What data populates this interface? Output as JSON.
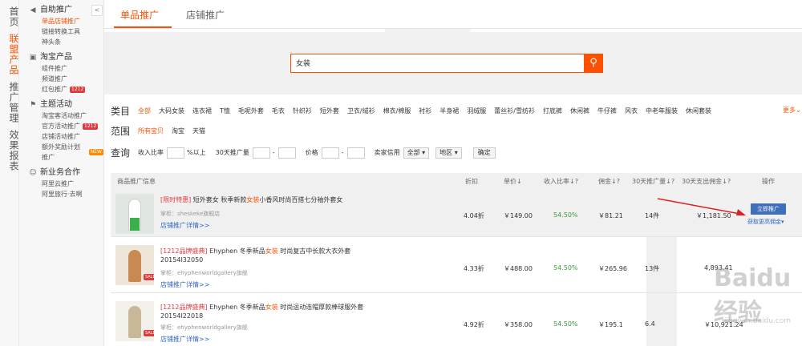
{
  "vnav": [
    "首页",
    "联盟产品",
    "推广管理",
    "效果报表"
  ],
  "sidebar": {
    "groups": [
      {
        "title": "自助推广",
        "items": [
          "单品店铺推广",
          "链接转换工具",
          "神头条"
        ]
      },
      {
        "title": "淘宝产品",
        "items": [
          "组件推广",
          "频道推广",
          "红包推广"
        ]
      },
      {
        "title": "主题活动",
        "items": [
          "淘宝客活动推广",
          "官方活动推广",
          "店铺活动推广",
          "额外奖励计划推广"
        ]
      },
      {
        "title": "新业务合作",
        "items": [
          "阿里云推广",
          "阿里旅行·去啊"
        ]
      }
    ],
    "collapse": "<"
  },
  "tabs": [
    "单品推广",
    "店铺推广"
  ],
  "search": {
    "value": "女装",
    "button": "搜索"
  },
  "filters": {
    "category_label": "类目",
    "categories": [
      "全部",
      "大码女装",
      "连衣裙",
      "T恤",
      "毛呢外套",
      "毛衣",
      "针织衫",
      "短外套",
      "卫衣/绒衫",
      "棉衣/棉服",
      "衬衫",
      "半身裙",
      "羽绒服",
      "蕾丝衫/雪纺衫",
      "打底裤",
      "休闲裤",
      "牛仔裤",
      "风衣",
      "中老年服装",
      "休闲套装"
    ],
    "more": "更多",
    "scope_label": "范围",
    "scopes": [
      "所有宝贝",
      "淘宝",
      "天猫"
    ],
    "query_label": "查询",
    "income_ratio": "收入比率",
    "percent_above": "%以上",
    "sales_30": "30天推广量",
    "price": "价格",
    "seller_credit": "卖家信用",
    "credit_value": "全部",
    "region": "地区",
    "confirm": "确定"
  },
  "table": {
    "headers": [
      "商品推广信息",
      "折扣",
      "单价",
      "收入比率",
      "佣金",
      "30天推广量",
      "30天支出佣金",
      "操作"
    ],
    "rows": [
      {
        "tag": "[限时特惠]",
        "title_a": " 短外套女 秋季新款",
        "kw": "女装",
        "title_b": "小香风时尚百搭七分袖外套女",
        "line2": "",
        "shop": "掌柜：sheskeke旗舰店",
        "link": "店铺推广详情>>",
        "discount": "4.04折",
        "price": "￥149.00",
        "ratio": "54.50%",
        "commission": "￥81.21",
        "sales": "14件",
        "spent": "￥1,181.50"
      },
      {
        "tag": "[1212品牌盛典]",
        "title_a": " Ehyphen 冬季新品",
        "kw": "女装",
        "title_b": " 时尚复古中长款大衣外套",
        "line2": "20154I32050",
        "shop": "掌柜：ehyphenworldgallery旗舰",
        "link": "店铺推广详情>>",
        "discount": "4.33折",
        "price": "￥488.00",
        "ratio": "54.50%",
        "commission": "￥265.96",
        "sales": "13件",
        "spent": "4,893.41"
      },
      {
        "tag": "[1212品牌盛典]",
        "title_a": " Ehyphen 冬季新品",
        "kw": "女装",
        "title_b": " 时尚运动连帽厚款棒球服外套",
        "line2": "20154I22018",
        "shop": "掌柜：ehyphenworldgallery旗舰",
        "link": "店铺推广详情>>",
        "discount": "4.92折",
        "price": "￥358.00",
        "ratio": "54.50%",
        "commission": "￥195.1",
        "sales": "6.4",
        "spent": "￥10,921.24"
      }
    ],
    "promote": "立即推广",
    "get_more": "获取更高佣金"
  },
  "watermark": "Baidu经验",
  "watermark_url": "jingyan.baidu.com"
}
